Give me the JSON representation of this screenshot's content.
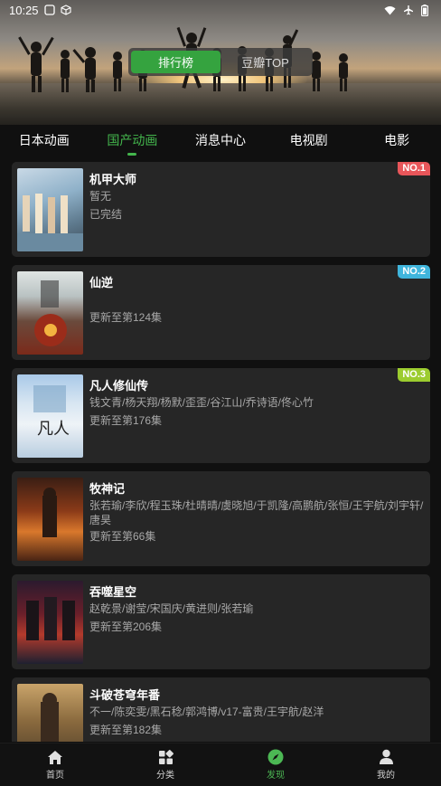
{
  "status": {
    "time": "10:25"
  },
  "segment": {
    "items": [
      "排行榜",
      "豆瓣TOP"
    ],
    "active": 0
  },
  "tabs": [
    "日本动画",
    "国产动画",
    "消息中心",
    "电视剧",
    "电影"
  ],
  "active_tab": 1,
  "cards": [
    {
      "title": "机甲大师",
      "lines": [
        "暂无",
        "已完结"
      ],
      "badge": "NO.1",
      "badge_color": "#e8565a"
    },
    {
      "title": "仙逆",
      "lines": [
        "",
        "更新至第124集"
      ],
      "badge": "NO.2",
      "badge_color": "#3fb5dc"
    },
    {
      "title": "凡人修仙传",
      "lines": [
        "钱文青/杨天翔/杨默/歪歪/谷江山/乔诗语/佟心竹",
        "更新至第176集"
      ],
      "badge": "NO.3",
      "badge_color": "#9ccc2f"
    },
    {
      "title": "牧神记",
      "lines": [
        "张若瑜/李欣/程玉珠/杜晴晴/虞晓旭/于凯隆/高鹏航/张恒/王宇航/刘宇轩/",
        "唐昊",
        "更新至第66集"
      ]
    },
    {
      "title": "吞噬星空",
      "lines": [
        "赵乾景/谢莹/宋国庆/黄进则/张若瑜",
        "更新至第206集"
      ]
    },
    {
      "title": "斗破苍穹年番",
      "lines": [
        "不一/陈奕雯/黑石稔/郭鸿博/v17-富贵/王宇航/赵洋",
        "更新至第182集"
      ]
    }
  ],
  "nav": [
    "首页",
    "分类",
    "发现",
    "我的"
  ],
  "active_nav": 2,
  "colors": {
    "accent": "#43b54c",
    "card_bg": "#262626",
    "background": "#101010"
  }
}
